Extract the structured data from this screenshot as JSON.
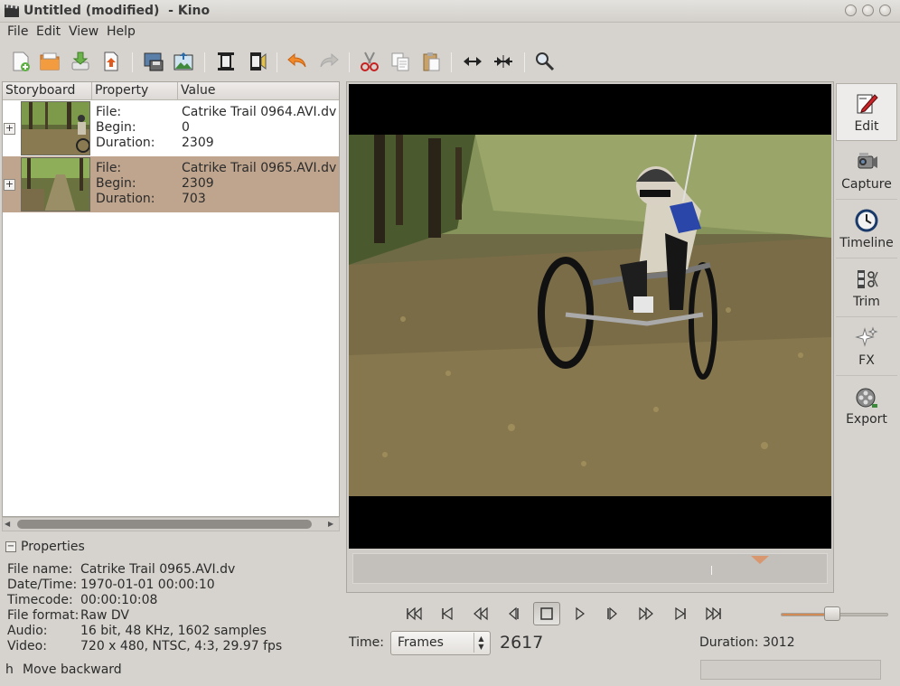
{
  "window": {
    "title": "Untitled (modified)  - Kino"
  },
  "menu": [
    "File",
    "Edit",
    "View",
    "Help"
  ],
  "toolbar": {
    "buttons": [
      "new-file",
      "open-file",
      "save-file",
      "export-file",
      "save-frame",
      "publish-frame",
      "split-scene",
      "join-scenes",
      "undo",
      "redo",
      "cut",
      "copy",
      "paste",
      "expand",
      "collapse",
      "zoom"
    ]
  },
  "storyboard": {
    "columns": [
      "Storyboard",
      "Property",
      "Value"
    ],
    "rows": [
      {
        "labels": [
          "File:",
          "Begin:",
          "Duration:"
        ],
        "values": [
          "Catrike Trail 0964.AVI.dv",
          "0",
          "2309"
        ],
        "selected": false
      },
      {
        "labels": [
          "File:",
          "Begin:",
          "Duration:"
        ],
        "values": [
          "Catrike Trail 0965.AVI.dv",
          "2309",
          "703"
        ],
        "selected": true
      }
    ]
  },
  "properties": {
    "title": "Properties",
    "items": [
      {
        "label": "File name:",
        "value": "Catrike Trail 0965.AVI.dv"
      },
      {
        "label": "Date/Time:",
        "value": "1970-01-01 00:00:10"
      },
      {
        "label": "Timecode:",
        "value": "00:00:10:08"
      },
      {
        "label": "File format:",
        "value": "Raw DV"
      },
      {
        "label": "Audio:",
        "value": "16 bit, 48 KHz, 1602 samples"
      },
      {
        "label": "Video:",
        "value": "720 x 480, NTSC, 4:3, 29.97 fps"
      }
    ]
  },
  "modes": [
    {
      "label": "Edit",
      "icon": "edit-icon",
      "active": true
    },
    {
      "label": "Capture",
      "icon": "camcorder-icon",
      "active": false
    },
    {
      "label": "Timeline",
      "icon": "clock-icon",
      "active": false
    },
    {
      "label": "Trim",
      "icon": "trim-icon",
      "active": false
    },
    {
      "label": "FX",
      "icon": "sparkle-icon",
      "active": false
    },
    {
      "label": "Export",
      "icon": "film-reel-icon",
      "active": false
    }
  ],
  "transport": [
    "first-scene",
    "previous-scene",
    "rewind",
    "step-back",
    "stop",
    "play",
    "step-forward",
    "fast-forward",
    "next-scene",
    "last-scene"
  ],
  "playback": {
    "time_label": "Time:",
    "time_format": "Frames",
    "frame": "2617",
    "duration": "Duration: 3012",
    "volume": 0.48
  },
  "status": {
    "key": "h",
    "message": "Move backward"
  },
  "colors": {
    "selection": "#bfa58d",
    "window_bg": "#d6d3ce",
    "accent": "#d28a55"
  }
}
